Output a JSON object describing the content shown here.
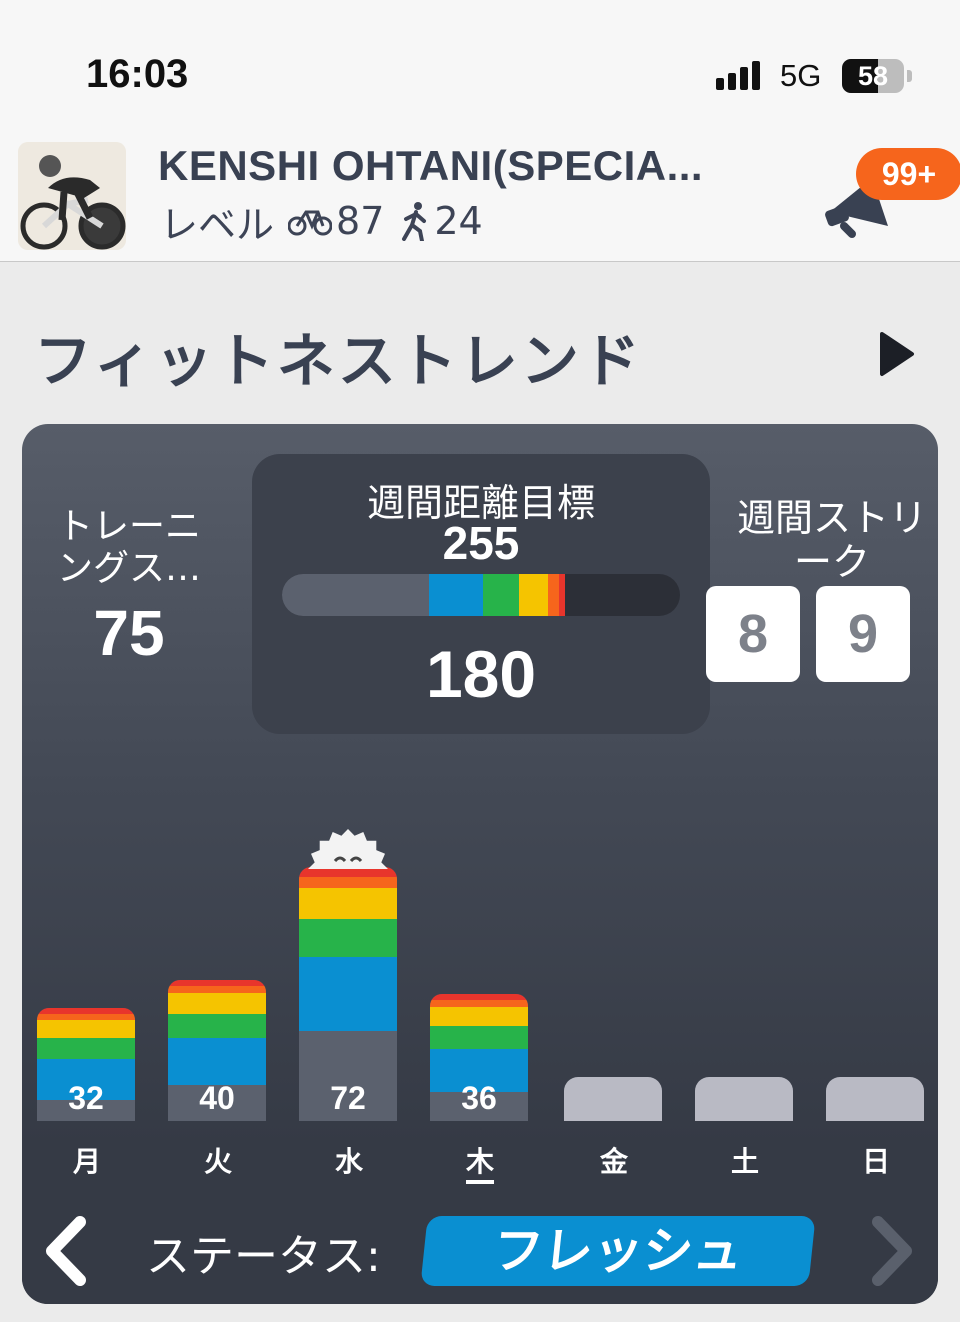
{
  "status_bar": {
    "time": "16:03",
    "network": "5G",
    "battery": "58",
    "battery_level": 0.58
  },
  "profile": {
    "name": "KENSHI OHTANI(SPECIA...",
    "level_label": "レベル",
    "cycling_icon": "bicycle-icon",
    "cycling_level": "87",
    "running_icon": "runner-icon",
    "running_level": "24",
    "notifications_badge": "99+"
  },
  "fitness_trends": {
    "title": "フィットネストレンド",
    "training_score_label": "トレーニングス…",
    "training_score_value": "75",
    "weekly_goal_label": "週間距離目標",
    "weekly_goal_target": "255",
    "weekly_goal_value": "180",
    "weekly_goal_progress": 0.71,
    "weekly_streak_label": "週間ストリーク",
    "weekly_streak_digits": [
      "8",
      "9"
    ]
  },
  "chart_data": {
    "type": "bar",
    "categories": [
      "月",
      "火",
      "水",
      "木",
      "金",
      "土",
      "日"
    ],
    "values": [
      32,
      40,
      72,
      36,
      0,
      0,
      0
    ],
    "value_labels": [
      "32",
      "40",
      "72",
      "36",
      "",
      "",
      ""
    ],
    "today_index": 3,
    "stack_colors": [
      "#5b616e",
      "#0a8fd1",
      "#27b34a",
      "#f5c400",
      "#f6651c",
      "#e8352c"
    ]
  },
  "footer": {
    "status_label": "ステータス:",
    "status_value": "フレッシュ"
  },
  "colors": {
    "accent_orange": "#f6651c",
    "status_blue": "#0a8fd1",
    "text_dark": "#394152"
  }
}
